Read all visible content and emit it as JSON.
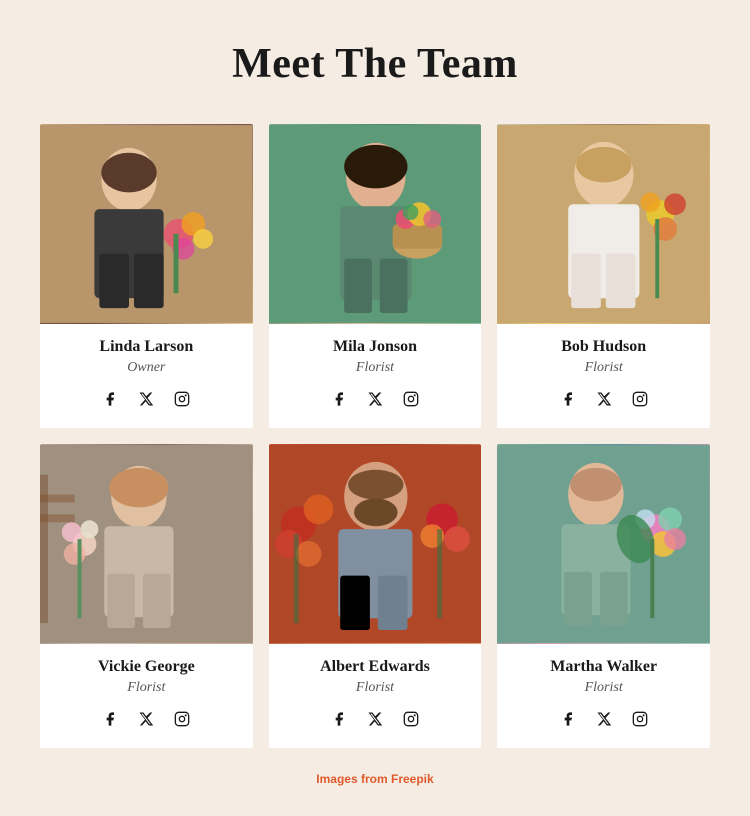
{
  "page": {
    "title": "Meet The Team",
    "background_color": "#f5ede4"
  },
  "footer": {
    "note": "Images from ",
    "source": "Freepik"
  },
  "team": [
    {
      "id": "linda",
      "name": "Linda Larson",
      "role": "Owner",
      "photo_class": "photo-linda",
      "social": [
        "facebook",
        "x",
        "instagram"
      ]
    },
    {
      "id": "mila",
      "name": "Mila Jonson",
      "role": "Florist",
      "photo_class": "photo-mila",
      "social": [
        "facebook",
        "x",
        "instagram"
      ]
    },
    {
      "id": "bob",
      "name": "Bob Hudson",
      "role": "Florist",
      "photo_class": "photo-bob",
      "social": [
        "facebook",
        "x",
        "instagram"
      ]
    },
    {
      "id": "vickie",
      "name": "Vickie George",
      "role": "Florist",
      "photo_class": "photo-vickie",
      "social": [
        "facebook",
        "x",
        "instagram"
      ]
    },
    {
      "id": "albert",
      "name": "Albert Edwards",
      "role": "Florist",
      "photo_class": "photo-albert",
      "social": [
        "facebook",
        "x",
        "instagram"
      ]
    },
    {
      "id": "martha",
      "name": "Martha Walker",
      "role": "Florist",
      "photo_class": "photo-martha",
      "social": [
        "facebook",
        "x",
        "instagram"
      ]
    }
  ]
}
